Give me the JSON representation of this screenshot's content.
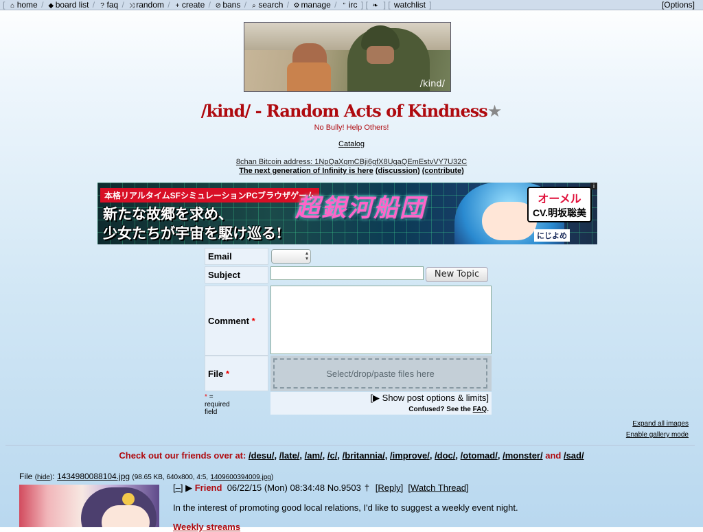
{
  "nav": {
    "items": [
      {
        "icon": "home-icon",
        "glyph": "⌂",
        "label": "home"
      },
      {
        "icon": "tag-icon",
        "glyph": "◆",
        "label": "board list"
      },
      {
        "icon": "question-icon",
        "glyph": "?",
        "label": "faq"
      },
      {
        "icon": "shuffle-icon",
        "glyph": "⤨",
        "label": "random"
      },
      {
        "icon": "plus-icon",
        "glyph": "+",
        "label": "create"
      },
      {
        "icon": "ban-icon",
        "glyph": "⊘",
        "label": "bans"
      },
      {
        "icon": "search-icon",
        "glyph": "⌕",
        "label": "search"
      },
      {
        "icon": "gear-icon",
        "glyph": "⚙",
        "label": "manage"
      },
      {
        "icon": "quote-icon",
        "glyph": "”",
        "label": "irc"
      }
    ],
    "twitter_glyph": "❧",
    "watchlist": "watchlist",
    "options": "[Options]"
  },
  "banner": {
    "label": "/kind/"
  },
  "board": {
    "title": "/kind/ - Random Acts of Kindness",
    "star": "★",
    "subtitle": "No Bully! Help Others!",
    "catalog": "Catalog",
    "bitcoin": "8chan Bitcoin address: 1NpQaXqmCBji6gfX8UgaQEmEstvVY7U32C",
    "infinity_text": "The next generation of Infinity is here",
    "infinity_discussion": "(discussion)",
    "infinity_contribute": "(contribute)"
  },
  "ad": {
    "tag": "本格リアルタイムSFシミュレーションPCブラウザゲーム",
    "line1": "新たな故郷を求め、",
    "line2": "少女たちが宇宙を駆け巡る!",
    "logo": "超銀河船団",
    "cv1": "オーメル",
    "cv2": "CV.明坂聡美",
    "publisher": "にじよめ",
    "info": "i"
  },
  "form": {
    "email_label": "Email",
    "subject_label": "Subject",
    "subject_value": "",
    "new_topic": "New Topic",
    "comment_label": "Comment",
    "file_label": "File",
    "required_mark": "*",
    "file_placeholder": "Select/drop/paste files here",
    "required_note": "= required field",
    "show_options": "[▶ Show post options & limits]",
    "confused": "Confused? See the",
    "faq": "FAQ",
    "period": "."
  },
  "links": {
    "expand": "Expand all images",
    "gallery": "Enable gallery mode"
  },
  "friends": {
    "prefix": "Check out our friends over at:",
    "boards": [
      "/desu/",
      "/late/",
      "/am/",
      "/c/",
      "/britannia/",
      "/improve/",
      "/doc/",
      "/otomad/",
      "/monster/"
    ],
    "and": "and",
    "last": "/sad/"
  },
  "thread": {
    "file_prefix": "File",
    "hide": "hide",
    "filename": "1434980088104.jpg",
    "meta": "(98.65 KB, 640x800, 4:5,",
    "orig_name": "1409600394009.jpg",
    "meta_end": ")",
    "collapse": "[–]",
    "arrow": "▶",
    "name": "Friend",
    "date": "06/22/15 (Mon) 08:34:48",
    "number": "No.9503",
    "pin": "†",
    "reply": "[Reply]",
    "watch": "[Watch Thread]",
    "body_line1": "In the interest of promoting good local relations, I'd like to suggest a weekly event night.",
    "body_line2": "Weekly streams"
  }
}
